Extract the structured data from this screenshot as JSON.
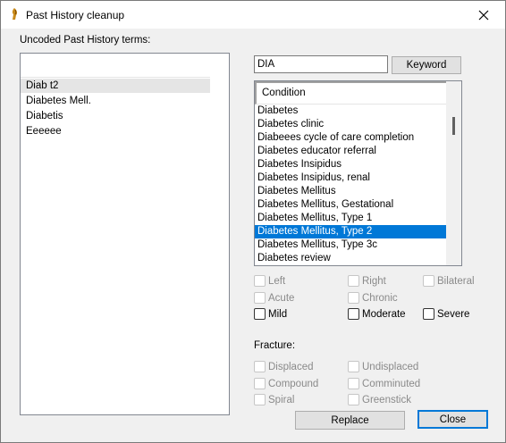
{
  "window": {
    "title": "Past History cleanup",
    "close_label": "✕"
  },
  "left": {
    "label": "Uncoded Past History terms:",
    "items": [
      "Diab t2",
      "Diabetes Mell.",
      "Diabetis",
      "Eeeeee"
    ],
    "selected_index": 0
  },
  "search": {
    "value": "DIA",
    "keyword_button": "Keyword"
  },
  "conditions": {
    "header": "Condition",
    "items": [
      "Diabetes",
      "Diabetes clinic",
      "Diabeees cycle of care completion",
      "Diabetes educator referral",
      "Diabetes Insipidus",
      "Diabetes Insipidus, renal",
      "Diabetes Mellitus",
      "Diabetes Mellitus, Gestational",
      "Diabetes Mellitus, Type 1",
      "Diabetes Mellitus, Type 2",
      "Diabetes Mellitus, Type 3c",
      "Diabetes review"
    ],
    "selected_index": 9
  },
  "qualifiers": {
    "left": "Left",
    "right": "Right",
    "bilateral": "Bilateral",
    "acute": "Acute",
    "chronic": "Chronic",
    "mild": "Mild",
    "moderate": "Moderate",
    "severe": "Severe"
  },
  "fracture": {
    "label": "Fracture:",
    "displaced": "Displaced",
    "undisplaced": "Undisplaced",
    "compound": "Compound",
    "comminuted": "Comminuted",
    "spiral": "Spiral",
    "greenstick": "Greenstick"
  },
  "buttons": {
    "replace": "Replace",
    "close": "Close"
  },
  "colors": {
    "selection": "#0078d7",
    "left_selection": "#e5e5e5"
  }
}
